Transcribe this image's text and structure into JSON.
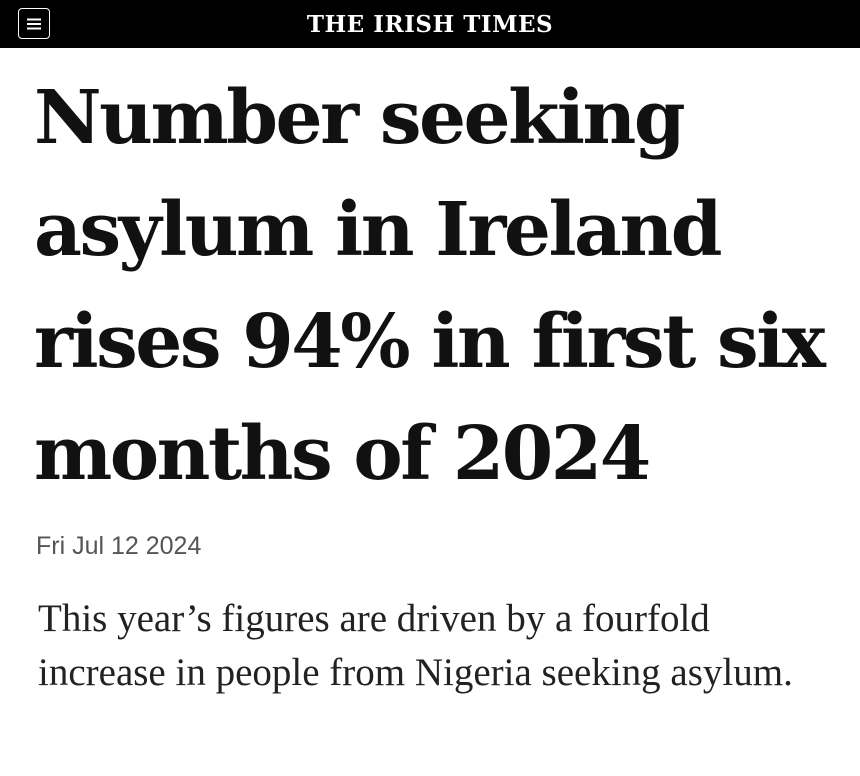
{
  "header": {
    "masthead": "THE IRISH TIMES",
    "menu_icon": "hamburger-menu-icon",
    "background_color": "#000000",
    "text_color": "#ffffff"
  },
  "article": {
    "headline": "Number seeking asylum in Ireland rises 94% in first six months of 2024",
    "date": "Fri Jul 12 2024",
    "standfirst": "This year’s figures are driven by a fourfold increase in people from Nigeria seeking asylum."
  }
}
